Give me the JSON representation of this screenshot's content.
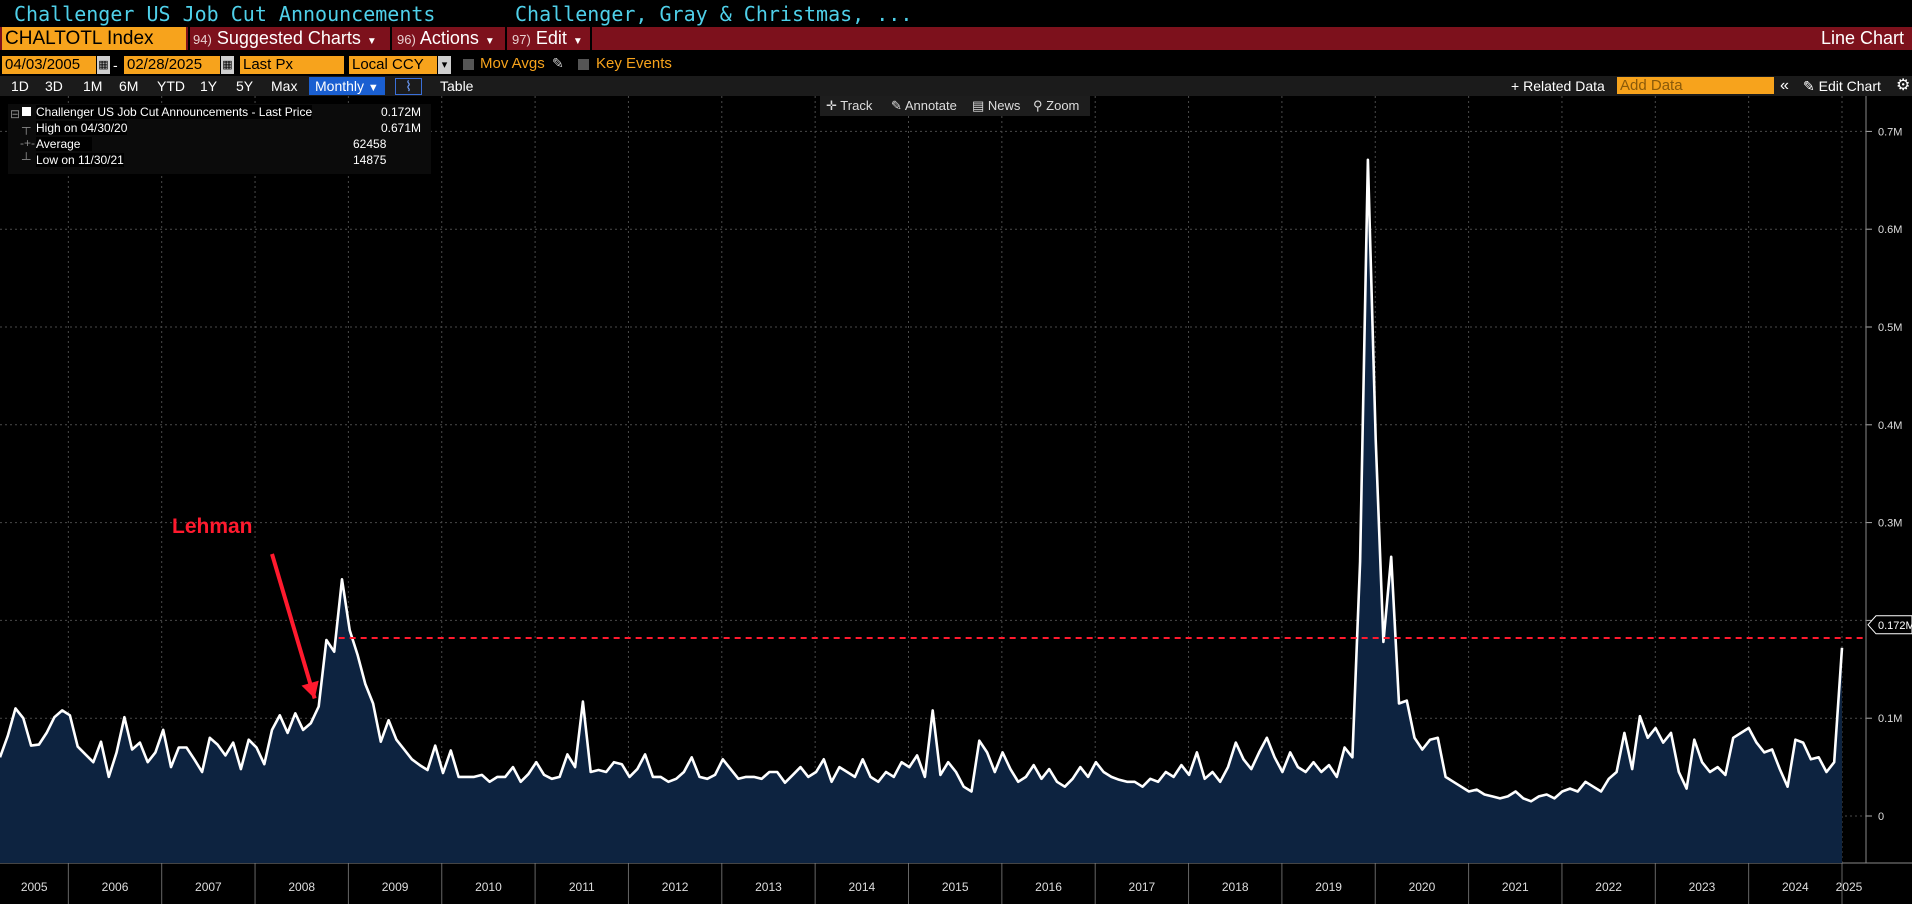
{
  "header": {
    "title": "Challenger US Job Cut Announcements",
    "source": "Challenger, Gray & Christmas, ..."
  },
  "toolbar": {
    "ticker": "CHALTOTL Index",
    "suggested": {
      "num": "94)",
      "label": "Suggested Charts"
    },
    "actions": {
      "num": "96)",
      "label": "Actions"
    },
    "edit": {
      "num": "97)",
      "label": "Edit"
    },
    "chart_type": "Line Chart"
  },
  "settings": {
    "start_date": "04/03/2005",
    "end_date": "02/28/2025",
    "field": "Last Px",
    "currency": "Local CCY",
    "mov_avgs": "Mov Avgs",
    "key_events": "Key Events"
  },
  "periods": [
    "1D",
    "3D",
    "1M",
    "6M",
    "YTD",
    "1Y",
    "5Y",
    "Max"
  ],
  "frequency": "Monthly",
  "table_label": "Table",
  "related_data": "Related Data",
  "add_data_placeholder": "Add Data",
  "edit_chart": "Edit Chart",
  "chart_tools": [
    "Track",
    "Annotate",
    "News",
    "Zoom"
  ],
  "legend": {
    "series": "Challenger US Job Cut Announcements - Last Price",
    "series_value": "0.172M",
    "high_label": "High on 04/30/20",
    "high_value": "0.671M",
    "avg_label": "Average",
    "avg_value": "62458",
    "low_label": "Low on 11/30/21",
    "low_value": "14875"
  },
  "colors": {
    "accent_orange": "#f7a31c",
    "toolbar_red": "#7d111c",
    "title_cyan": "#4fd0e9",
    "line": "#ffffff",
    "area_fill": "#0d2340",
    "annotation_red": "#ff1a2e"
  },
  "chart_data": {
    "type": "area",
    "y_ticks": [
      "0",
      "0.1M",
      "0.2M",
      "0.3M",
      "0.4M",
      "0.5M",
      "0.6M",
      "0.7M"
    ],
    "ylim": [
      -0.047,
      0.78
    ],
    "x_ticks": [
      "2005",
      "2006",
      "2007",
      "2008",
      "2009",
      "2010",
      "2011",
      "2012",
      "2013",
      "2014",
      "2015",
      "2016",
      "2017",
      "2018",
      "2019",
      "2020",
      "2021",
      "2022",
      "2023",
      "2024",
      "2025"
    ],
    "last_value_label": "0.172M",
    "reference_line": 0.182,
    "annotation": {
      "text": "Lehman",
      "date": "2008-09"
    },
    "series": [
      {
        "name": "Challenger US Job Cut Announcements - Last Price",
        "start": "2005-04",
        "values": [
          0.06,
          0.082,
          0.11,
          0.1,
          0.072,
          0.073,
          0.085,
          0.101,
          0.108,
          0.103,
          0.071,
          0.063,
          0.055,
          0.076,
          0.04,
          0.065,
          0.101,
          0.068,
          0.075,
          0.055,
          0.065,
          0.088,
          0.05,
          0.07,
          0.07,
          0.058,
          0.045,
          0.08,
          0.073,
          0.062,
          0.075,
          0.048,
          0.078,
          0.07,
          0.053,
          0.088,
          0.103,
          0.085,
          0.105,
          0.088,
          0.095,
          0.112,
          0.18,
          0.168,
          0.242,
          0.19,
          0.165,
          0.135,
          0.115,
          0.076,
          0.098,
          0.078,
          0.068,
          0.058,
          0.052,
          0.047,
          0.072,
          0.044,
          0.067,
          0.04,
          0.04,
          0.04,
          0.042,
          0.035,
          0.04,
          0.04,
          0.05,
          0.035,
          0.043,
          0.055,
          0.042,
          0.038,
          0.04,
          0.063,
          0.05,
          0.117,
          0.045,
          0.047,
          0.045,
          0.055,
          0.053,
          0.04,
          0.048,
          0.063,
          0.04,
          0.04,
          0.035,
          0.038,
          0.045,
          0.06,
          0.04,
          0.038,
          0.042,
          0.058,
          0.048,
          0.038,
          0.04,
          0.04,
          0.038,
          0.045,
          0.045,
          0.034,
          0.042,
          0.05,
          0.04,
          0.045,
          0.058,
          0.035,
          0.05,
          0.045,
          0.04,
          0.058,
          0.04,
          0.035,
          0.045,
          0.04,
          0.055,
          0.05,
          0.062,
          0.04,
          0.108,
          0.042,
          0.055,
          0.045,
          0.03,
          0.025,
          0.077,
          0.065,
          0.045,
          0.065,
          0.048,
          0.035,
          0.04,
          0.052,
          0.038,
          0.048,
          0.035,
          0.03,
          0.038,
          0.05,
          0.04,
          0.055,
          0.045,
          0.04,
          0.037,
          0.035,
          0.035,
          0.03,
          0.038,
          0.035,
          0.045,
          0.04,
          0.052,
          0.042,
          0.065,
          0.038,
          0.045,
          0.035,
          0.05,
          0.075,
          0.058,
          0.048,
          0.065,
          0.08,
          0.06,
          0.045,
          0.065,
          0.05,
          0.045,
          0.055,
          0.045,
          0.052,
          0.04,
          0.07,
          0.06,
          0.26,
          0.671,
          0.385,
          0.178,
          0.265,
          0.115,
          0.118,
          0.08,
          0.068,
          0.078,
          0.08,
          0.04,
          0.035,
          0.03,
          0.025,
          0.027,
          0.022,
          0.02,
          0.018,
          0.02,
          0.025,
          0.018,
          0.015,
          0.02,
          0.022,
          0.018,
          0.025,
          0.028,
          0.025,
          0.035,
          0.03,
          0.025,
          0.038,
          0.045,
          0.085,
          0.048,
          0.102,
          0.08,
          0.09,
          0.075,
          0.085,
          0.045,
          0.028,
          0.078,
          0.055,
          0.045,
          0.05,
          0.042,
          0.08,
          0.085,
          0.09,
          0.075,
          0.065,
          0.068,
          0.048,
          0.03,
          0.078,
          0.075,
          0.058,
          0.06,
          0.045,
          0.055,
          0.172
        ]
      }
    ]
  }
}
